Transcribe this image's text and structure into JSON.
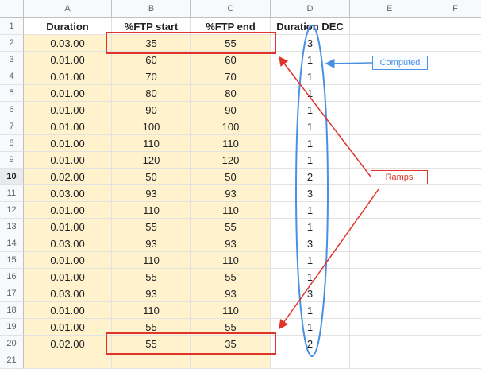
{
  "columns": [
    "A",
    "B",
    "C",
    "D",
    "E",
    "F"
  ],
  "rows": [
    {
      "n": "1",
      "cells": [
        "Duration",
        "%FTP start",
        "%FTP end",
        "Duration DEC",
        "",
        ""
      ]
    },
    {
      "n": "2",
      "cells": [
        "0.03.00",
        "35",
        "55",
        "3",
        "",
        ""
      ]
    },
    {
      "n": "3",
      "cells": [
        "0.01.00",
        "60",
        "60",
        "1",
        "",
        ""
      ]
    },
    {
      "n": "4",
      "cells": [
        "0.01.00",
        "70",
        "70",
        "1",
        "",
        ""
      ]
    },
    {
      "n": "5",
      "cells": [
        "0.01.00",
        "80",
        "80",
        "1",
        "",
        ""
      ]
    },
    {
      "n": "6",
      "cells": [
        "0.01.00",
        "90",
        "90",
        "1",
        "",
        ""
      ]
    },
    {
      "n": "7",
      "cells": [
        "0.01.00",
        "100",
        "100",
        "1",
        "",
        ""
      ]
    },
    {
      "n": "8",
      "cells": [
        "0.01.00",
        "110",
        "110",
        "1",
        "",
        ""
      ]
    },
    {
      "n": "9",
      "cells": [
        "0.01.00",
        "120",
        "120",
        "1",
        "",
        ""
      ]
    },
    {
      "n": "10",
      "cells": [
        "0.02.00",
        "50",
        "50",
        "2",
        "",
        ""
      ]
    },
    {
      "n": "11",
      "cells": [
        "0.03.00",
        "93",
        "93",
        "3",
        "",
        ""
      ]
    },
    {
      "n": "12",
      "cells": [
        "0.01.00",
        "110",
        "110",
        "1",
        "",
        ""
      ]
    },
    {
      "n": "13",
      "cells": [
        "0.01.00",
        "55",
        "55",
        "1",
        "",
        ""
      ]
    },
    {
      "n": "14",
      "cells": [
        "0.03.00",
        "93",
        "93",
        "3",
        "",
        ""
      ]
    },
    {
      "n": "15",
      "cells": [
        "0.01.00",
        "110",
        "110",
        "1",
        "",
        ""
      ]
    },
    {
      "n": "16",
      "cells": [
        "0.01.00",
        "55",
        "55",
        "1",
        "",
        ""
      ]
    },
    {
      "n": "17",
      "cells": [
        "0.03.00",
        "93",
        "93",
        "3",
        "",
        ""
      ]
    },
    {
      "n": "18",
      "cells": [
        "0.01.00",
        "110",
        "110",
        "1",
        "",
        ""
      ]
    },
    {
      "n": "19",
      "cells": [
        "0.01.00",
        "55",
        "55",
        "1",
        "",
        ""
      ]
    },
    {
      "n": "20",
      "cells": [
        "0.02.00",
        "55",
        "35",
        "2",
        "",
        ""
      ]
    },
    {
      "n": "21",
      "cells": [
        "",
        "",
        "",
        "",
        "",
        ""
      ]
    }
  ],
  "active_row": "10",
  "annotations": {
    "computed_label": "Computed",
    "ramps_label": "Ramps"
  },
  "colors": {
    "highlight": "#fff2cc",
    "annotation_blue": "#4a90e2",
    "annotation_red": "#e0342a"
  }
}
